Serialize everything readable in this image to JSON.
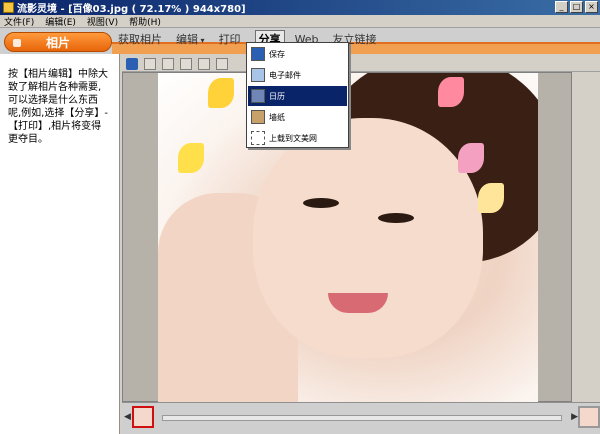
{
  "window": {
    "title": "流影灵境 - [百像03.jpg ( 72.17% ) 944x780]"
  },
  "menubar": {
    "items": [
      "文件(F)",
      "编辑(E)",
      "视图(V)",
      "帮助(H)"
    ]
  },
  "ribbon": {
    "album_tab": "相片",
    "nav": {
      "get_photo": "获取相片",
      "edit": "编辑",
      "print": "打印",
      "share": "分享",
      "web": "Web",
      "friend_link": "友立链接"
    }
  },
  "left_panel": {
    "description": "按【相片编辑】中除大致了解相片各种需要,可以选择是什么东西呢,例如,选择【分享】-【打印】,相片将变得更夺目。"
  },
  "share_menu": {
    "items": [
      "保存",
      "电子邮件",
      "日历",
      "墙纸",
      "上载到文美网"
    ],
    "active_index": 2
  }
}
